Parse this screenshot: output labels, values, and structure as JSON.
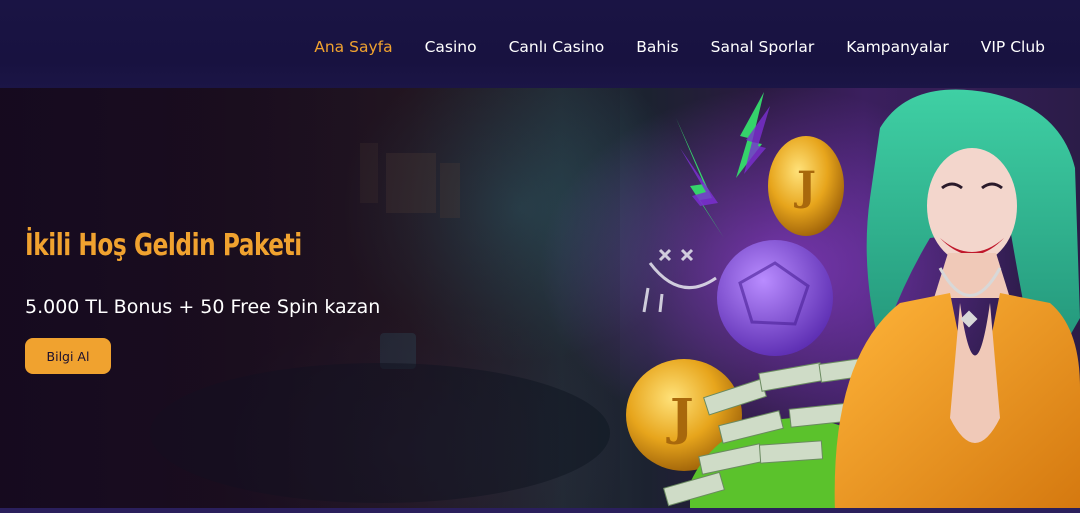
{
  "nav": {
    "items": [
      {
        "label": "Ana Sayfa",
        "active": true
      },
      {
        "label": "Casino",
        "active": false
      },
      {
        "label": "Canlı Casino",
        "active": false
      },
      {
        "label": "Bahis",
        "active": false
      },
      {
        "label": "Sanal Sporlar",
        "active": false
      },
      {
        "label": "Kampanyalar",
        "active": false
      },
      {
        "label": "VIP Club",
        "active": false
      }
    ]
  },
  "hero": {
    "title": "İkili Hoş Geldin Paketi",
    "subtitle": "5.000 TL Bonus + 50 Free Spin kazan",
    "cta_label": "Bilgi Al"
  },
  "colors": {
    "accent": "#f0a22f",
    "navbar_bg": "#1a1444",
    "text": "#ffffff"
  }
}
